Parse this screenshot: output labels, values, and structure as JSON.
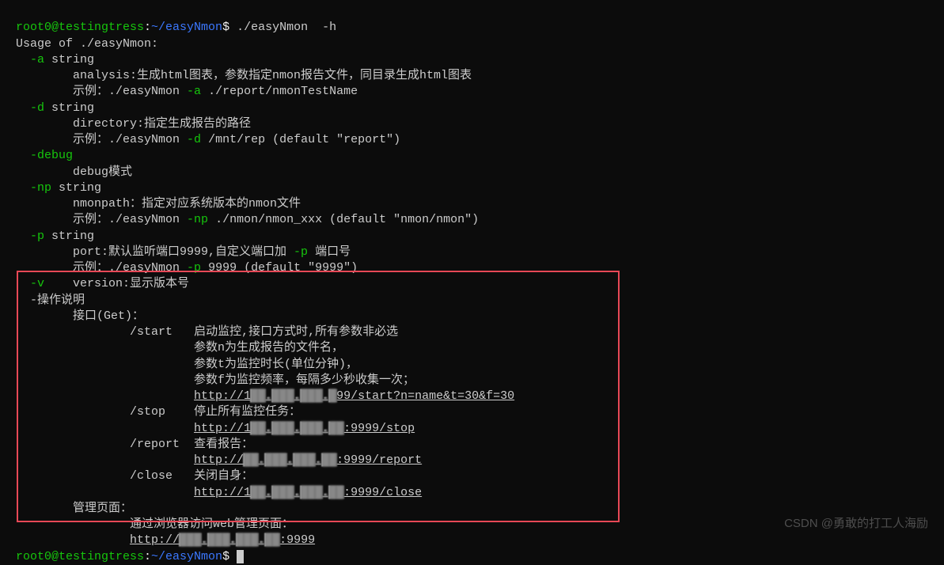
{
  "prompt1": {
    "user": "root0@testingtress",
    "path": "~/easyNmon",
    "symbol": "$",
    "command": "./easyNmon  -h"
  },
  "usage_line": "Usage of ./easyNmon:",
  "options": {
    "a": {
      "flag": "-a",
      "type": " string",
      "desc": "analysis:生成html图表，参数指定nmon报告文件，同目录生成html图表",
      "example_prefix": "示例：./easyNmon ",
      "example_flag": "-a",
      "example_suffix": " ./report/nmonTestName"
    },
    "d": {
      "flag": "-d",
      "type": " string",
      "desc": "directory:指定生成报告的路径",
      "example_prefix": "示例：./easyNmon ",
      "example_flag": "-d",
      "example_suffix": " /mnt/rep (default \"report\")"
    },
    "debug": {
      "flag": "-debug",
      "desc": "debug模式"
    },
    "np": {
      "flag": "-np",
      "type": " string",
      "desc": "nmonpath：指定对应系统版本的nmon文件",
      "example_prefix": "示例：./easyNmon ",
      "example_flag": "-np",
      "example_suffix": " ./nmon/nmon_xxx (default \"nmon/nmon\")"
    },
    "p": {
      "flag": "-p",
      "type": " string",
      "desc_prefix": "port:默认监听端口9999,自定义端口加 ",
      "desc_flag": "-p",
      "desc_suffix": " 端口号",
      "example_prefix": "示例：./easyNmon ",
      "example_flag": "-p",
      "example_suffix": " 9999 (default \"9999\")"
    },
    "v": {
      "flag": "-v",
      "desc": "version:显示版本号"
    }
  },
  "operation": {
    "title": "-操作说明",
    "get_label": "接口(Get)：",
    "start": {
      "endpoint": "/start",
      "desc1": "启动监控,接口方式时,所有参数非必选",
      "desc2": "参数n为生成报告的文件名，",
      "desc3": "参数t为监控时长(单位分钟)，",
      "desc4": "参数f为监控频率，每隔多少秒收集一次；",
      "url_prefix": "http://1",
      "url_blur": "██.███.███.█",
      "url_suffix": "99/start?n=name&t=30&f=30"
    },
    "stop": {
      "endpoint": "/stop",
      "desc": "停止所有监控任务：",
      "url_prefix": "http://1",
      "url_blur": "██.███.███.██",
      "url_suffix": ":9999/stop"
    },
    "report": {
      "endpoint": "/report",
      "desc": "查看报告：",
      "url_prefix": "http://",
      "url_blur": "██.███.███.██",
      "url_suffix": ":9999/report"
    },
    "close": {
      "endpoint": "/close",
      "desc": "关闭自身：",
      "url_prefix": "http://1",
      "url_blur": "██.███.███.██",
      "url_suffix": ":9999/close"
    },
    "admin": {
      "label": "管理页面：",
      "desc": "通过浏览器访问web管理页面：",
      "url_prefix": "http://",
      "url_blur": "███.███.███.██",
      "url_suffix": ":9999"
    }
  },
  "prompt2": {
    "user": "root0@testingtress",
    "path": "~/easyNmon",
    "symbol": "$ "
  },
  "watermark": "CSDN @勇敢的打工人海励",
  "redbox_style": "left:21px; top:342px; width:762px; height:318px;"
}
